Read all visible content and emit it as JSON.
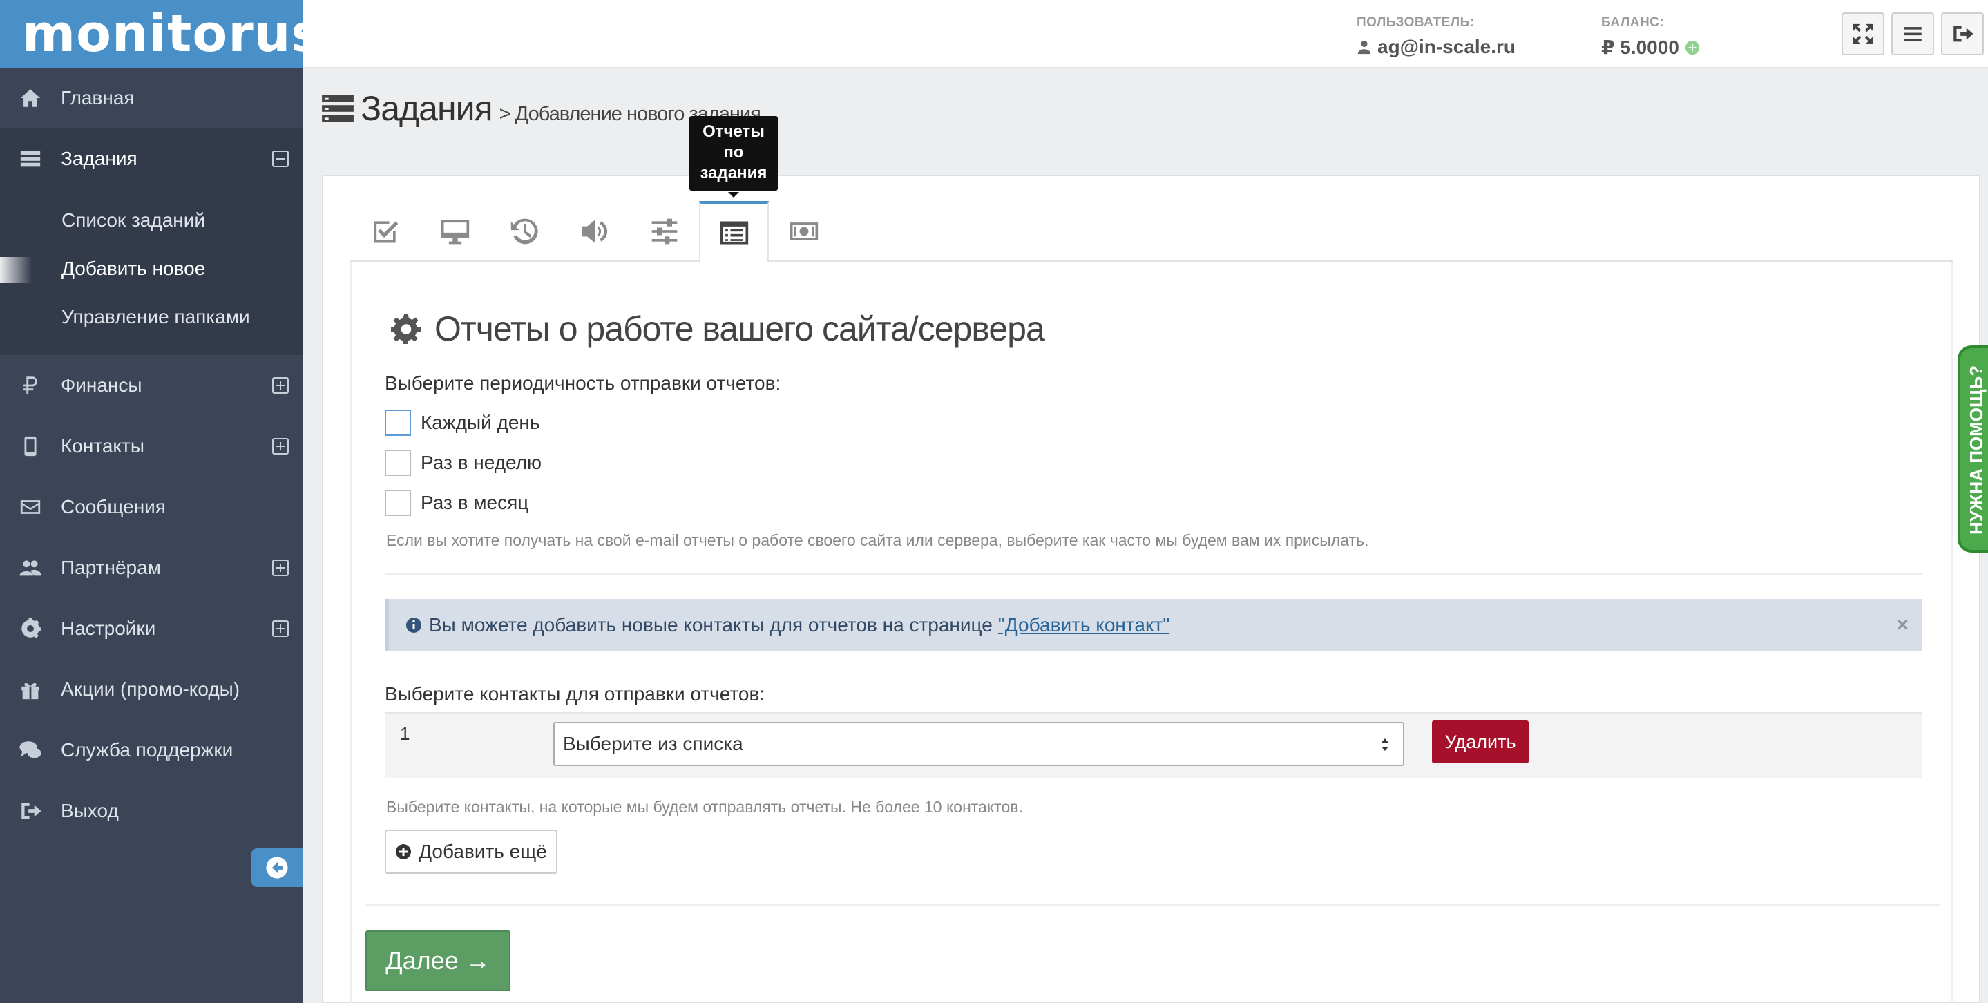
{
  "brand": "monitorus",
  "sidebar": {
    "items": [
      {
        "label": "Главная",
        "icon": "home-icon"
      },
      {
        "label": "Задания",
        "icon": "tasks-icon"
      },
      {
        "label": "Финансы",
        "icon": "ruble-icon"
      },
      {
        "label": "Контакты",
        "icon": "phone-icon"
      },
      {
        "label": "Сообщения",
        "icon": "envelope-icon"
      },
      {
        "label": "Партнёрам",
        "icon": "users-icon"
      },
      {
        "label": "Настройки",
        "icon": "gear-icon"
      },
      {
        "label": "Акции (промо-коды)",
        "icon": "gift-icon"
      },
      {
        "label": "Служба поддержки",
        "icon": "chat-icon"
      },
      {
        "label": "Выход",
        "icon": "signout-icon"
      }
    ],
    "submenu": [
      "Список заданий",
      "Добавить новое",
      "Управление папками"
    ]
  },
  "header": {
    "user_caption": "ПОЛЬЗОВАТЕЛЬ:",
    "user": "ag@in-scale.ru",
    "balance_caption": "БАЛАНС:",
    "balance": "₽ 5.0000"
  },
  "page": {
    "title": "Задания",
    "breadcrumb": "> Добавление нового задания"
  },
  "tooltip": "Отчеты по задания",
  "tooltip_lines": [
    "Отчеты",
    "по",
    "задания"
  ],
  "section": {
    "title": "Отчеты о работе вашего сайта/сервера",
    "period_label": "Выберите периодичность отправки отчетов:",
    "options": [
      "Каждый день",
      "Раз в неделю",
      "Раз в месяц"
    ],
    "period_hint": "Если вы хотите получать на свой e-mail отчеты о работе своего сайта или сервера, выберите как часто мы будем вам их присылать.",
    "alert_text": "Вы можете добавить новые контакты для отчетов на странице",
    "alert_link": "\"Добавить контакт\"",
    "alert_close": "×",
    "contacts_label": "Выберите контакты для отправки отчетов:",
    "row_number": "1",
    "select_value": "Выберите из списка",
    "delete_label": "Удалить",
    "contacts_hint": "Выберите контакты, на которые мы будем отправлять отчеты. Не более 10 контактов.",
    "add_more_label": "Добавить ещё",
    "next_label": "Далее →"
  },
  "help_tab": "НУЖНА ПОМОЩЬ?",
  "colors": {
    "sidebar": "#3c4557",
    "brand": "#4a90c8",
    "delete": "#a7102a",
    "next": "#5c9d63"
  }
}
